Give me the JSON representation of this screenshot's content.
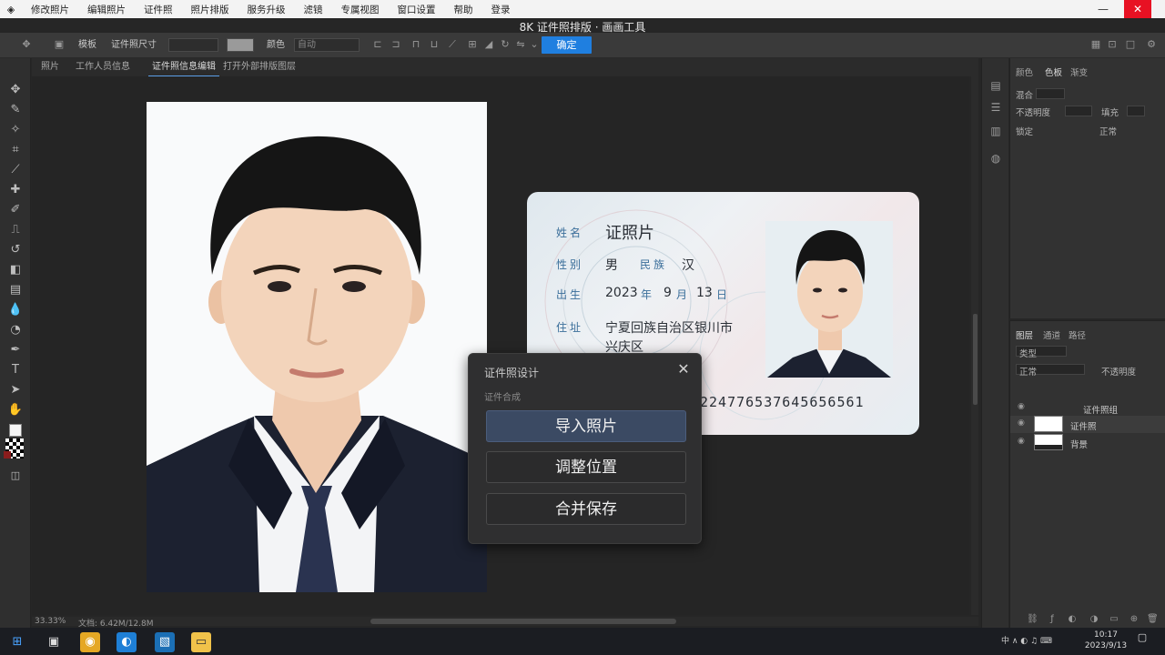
{
  "window": {
    "title": "8K 证件照排版 · 画画工具",
    "controls": {
      "minimize": "—",
      "maximize": "□",
      "close": "✕"
    }
  },
  "menu": [
    "修改照片",
    "编辑照片",
    "证件照",
    "照片排版",
    "服务升级",
    "滤镜",
    "专属视图",
    "窗口设置",
    "帮助",
    "登录"
  ],
  "options_bar": {
    "items": [
      "模板",
      "证件照尺寸",
      "颜色",
      "自动"
    ],
    "primary_button": "确定"
  },
  "tabs": [
    "照片",
    "工作人员信息",
    "证件照信息编辑",
    "打开外部排版图层"
  ],
  "id_card": {
    "name_label": "姓名",
    "name_value": "证照片",
    "sex_label": "性别",
    "sex_value": "男",
    "ethnic_label": "民族",
    "ethnic_value": "汉",
    "birth_label": "出生",
    "birth_year": "2023",
    "birth_year_unit": "年",
    "birth_month": "9",
    "birth_month_unit": "月",
    "birth_day": "13",
    "birth_day_unit": "日",
    "address_label": "住址",
    "address_line1": "宁夏回族自治区银川市",
    "address_line2": "兴庆区",
    "id_number": "224776537645656561"
  },
  "dialog": {
    "title": "证件照设计",
    "subtitle": "证件合成",
    "buttons": [
      "导入照片",
      "调整位置",
      "合并保存"
    ],
    "close": "✕"
  },
  "panels": {
    "top_tabs": [
      "颜色",
      "色板",
      "渐变"
    ],
    "rows": [
      "混合",
      "不透明度",
      "锁定",
      "填充",
      "正常"
    ],
    "layers_tabs": [
      "图层",
      "通道",
      "路径"
    ],
    "layer_filter": "类型",
    "blend_mode": "正常",
    "opacity_label": "不透明度",
    "layers": [
      {
        "name": "证件照组"
      },
      {
        "name": "证件照"
      },
      {
        "name": "背景"
      }
    ]
  },
  "status": {
    "zoom": "33.33%",
    "doc": "文档: 6.42M/12.8M"
  },
  "taskbar": {
    "time": "10:17",
    "date": "2023/9/13",
    "tray": "中 ∧ ◐ ♫ ⌨"
  }
}
